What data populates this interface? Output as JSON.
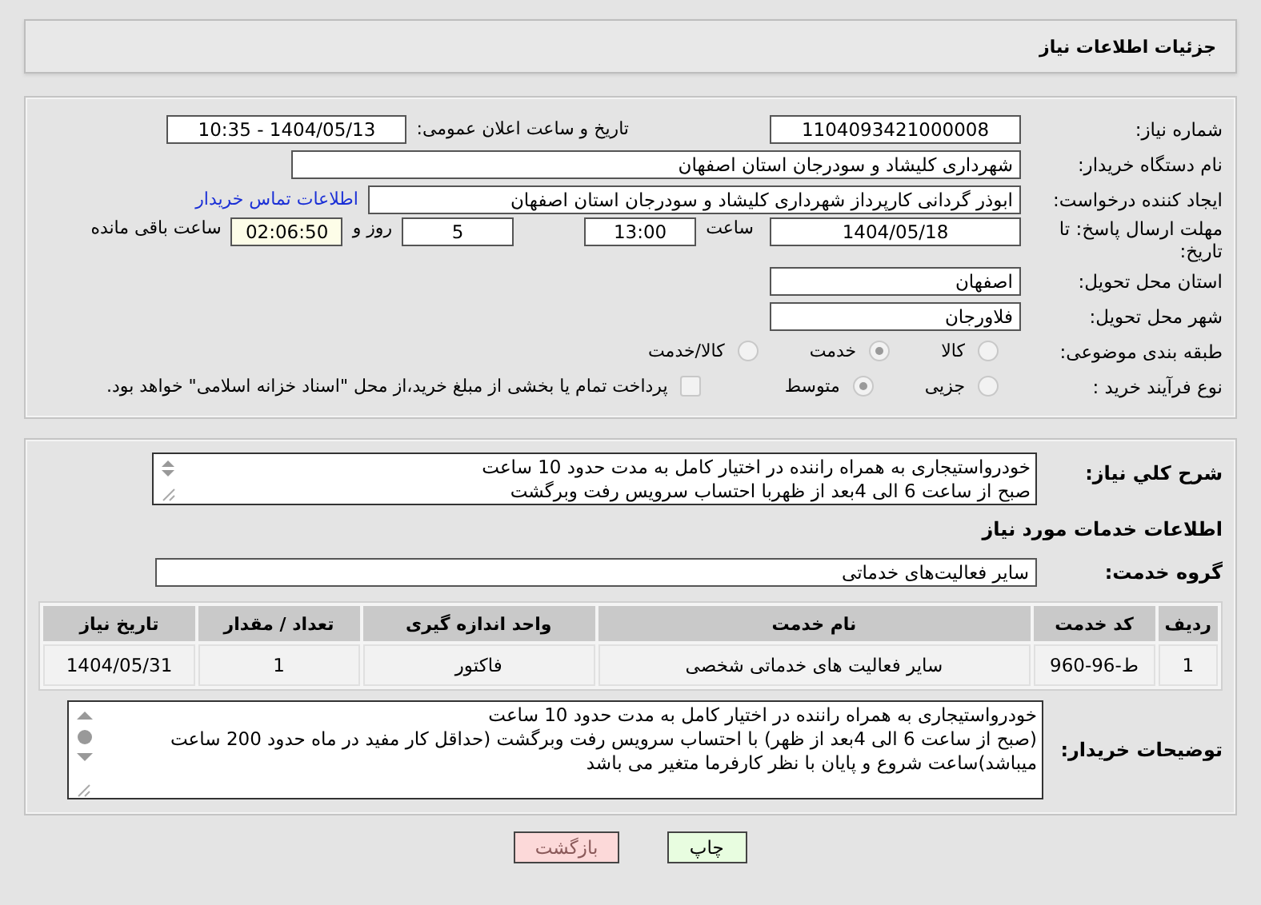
{
  "header": {
    "title": "جزئیات اطلاعات نیاز"
  },
  "details": {
    "need_number": {
      "label": "شماره نیاز:",
      "value": "1104093421000008"
    },
    "announce": {
      "label": "تاریخ و ساعت اعلان عمومی:",
      "value": "1404/05/13 - 10:35"
    },
    "buyer_org": {
      "label": "نام دستگاه خریدار:",
      "value": "شهرداری کلیشاد و سودرجان استان اصفهان"
    },
    "requester": {
      "label": "ایجاد کننده درخواست:",
      "value": "ابوذر گردانی کارپرداز شهرداری کلیشاد و سودرجان استان اصفهان",
      "link": "اطلاعات تماس خریدار"
    },
    "deadline": {
      "label": "مهلت ارسال پاسخ: تا تاریخ:",
      "date": "1404/05/18",
      "time_label": "ساعت",
      "time": "13:00",
      "days": "5",
      "days_label": "روز و",
      "remaining": "02:06:50",
      "remaining_label": "ساعت باقی مانده"
    },
    "province": {
      "label": "استان محل تحویل:",
      "value": "اصفهان"
    },
    "city": {
      "label": "شهر محل تحویل:",
      "value": "فلاورجان"
    },
    "category": {
      "label": "طبقه بندی موضوعی:",
      "options": [
        {
          "label": "کالا",
          "selected": false
        },
        {
          "label": "خدمت",
          "selected": true
        },
        {
          "label": "کالا/خدمت",
          "selected": false
        }
      ]
    },
    "process": {
      "label": "نوع فرآیند خرید :",
      "options": [
        {
          "label": "جزیی",
          "selected": false
        },
        {
          "label": "متوسط",
          "selected": true
        }
      ],
      "payment": {
        "label": "پرداخت تمام یا بخشی از مبلغ خرید،از محل \"اسناد خزانه اسلامی\" خواهد بود.",
        "checked": false
      }
    }
  },
  "needs": {
    "label": "شرح کلي نياز:",
    "text": "خودرواستیجاری به همراه راننده در اختیار کامل به مدت حدود 10 ساعت\nصبح از ساعت 6 الی 4بعد از ظهربا احتساب سرویس رفت وبرگشت"
  },
  "services": {
    "title": "اطلاعات خدمات مورد نیاز",
    "group_label": "گروه خدمت:",
    "group": "سایر فعالیت‌های خدماتی",
    "table": {
      "columns": [
        "ردیف",
        "کد خدمت",
        "نام خدمت",
        "واحد اندازه گیری",
        "تعداد / مقدار",
        "تاریخ نیاز"
      ],
      "rows": [
        [
          "1",
          "ط-96-960",
          "سایر فعالیت های خدماتی شخصی",
          "فاکتور",
          "1",
          "1404/05/31"
        ]
      ]
    }
  },
  "buyer_notes": {
    "label": "توضیحات خریدار:",
    "text": "خودرواستیجاری به همراه راننده در اختیار کامل به مدت حدود 10 ساعت\n(صبح از ساعت 6 الی 4بعد از ظهر) با احتساب سرویس رفت وبرگشت (حداقل کار مفید در ماه حدود 200 ساعت\nمیباشد)ساعت شروع و پایان با نظر کارفرما متغیر می باشد"
  },
  "buttons": [
    {
      "kind": "print",
      "label": "چاپ"
    },
    {
      "kind": "back",
      "label": "بازگشت"
    }
  ]
}
